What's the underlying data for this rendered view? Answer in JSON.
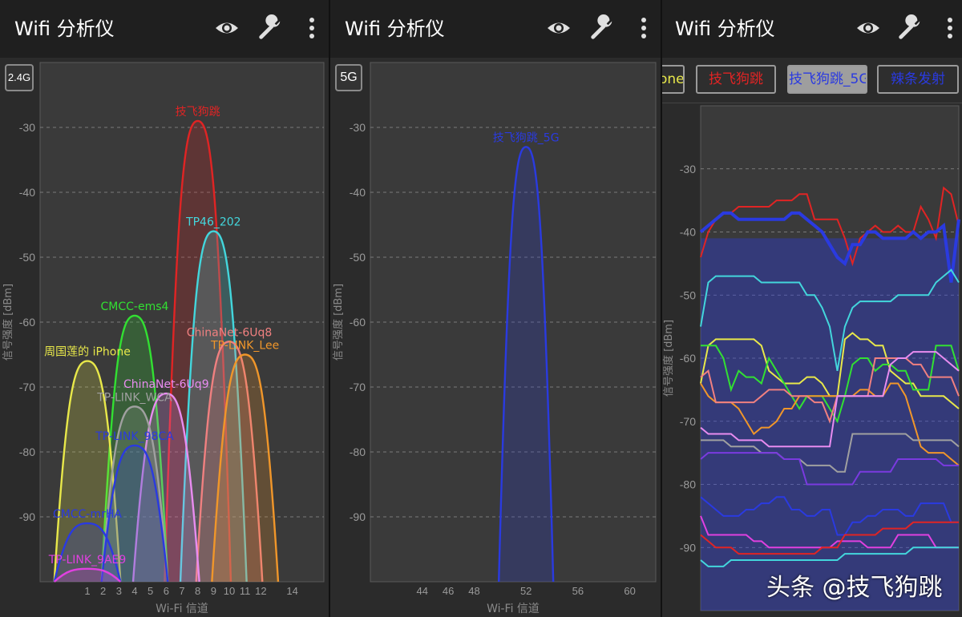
{
  "app": {
    "title": "Wifi 分析仪",
    "icons": [
      "eye-icon",
      "wrench-icon",
      "more-vert-icon"
    ]
  },
  "colors": {
    "bar": "#1f1f1f",
    "panel": "#2b2b2b",
    "plot": "#3a3a3a",
    "grid": "#8f8f8f",
    "axis": "#9a9a9a"
  },
  "panel1": {
    "band": "2.4G",
    "chart_data": {
      "type": "area",
      "xlabel": "Wi-Fi 信道",
      "ylabel": "信号强度 [dBm]",
      "ylim": [
        -100,
        -20
      ],
      "yticks": [
        -30,
        -40,
        -50,
        -60,
        -70,
        -80,
        -90
      ],
      "xticks": [
        1,
        2,
        3,
        4,
        5,
        6,
        7,
        8,
        9,
        10,
        11,
        12,
        14
      ],
      "xlim": [
        -2,
        16
      ],
      "grid": true,
      "series": [
        {
          "name": "技飞狗跳",
          "center": 8,
          "peak": -29,
          "color": "#e02424"
        },
        {
          "name": "TP46_202",
          "center": 9,
          "peak": -46,
          "color": "#43d6dc"
        },
        {
          "name": "CMCC-ems4",
          "center": 4,
          "peak": -59,
          "color": "#32e032"
        },
        {
          "name": "ChinaNet-6Uq8",
          "center": 10,
          "peak": -63,
          "color": "#f08080"
        },
        {
          "name": "TP-LINK_Lee",
          "center": 11,
          "peak": -65,
          "color": "#f0962a"
        },
        {
          "name": "周国莲的 iPhone",
          "center": 1,
          "peak": -66,
          "color": "#e8e84a"
        },
        {
          "name": "ChinaNet-6Uq9",
          "center": 6,
          "peak": -71,
          "color": "#e88cf0"
        },
        {
          "name": "TP-LINK_WCA",
          "center": 4,
          "peak": -73,
          "color": "#a0a0a0"
        },
        {
          "name": "TP-LINK_98CA",
          "center": 4,
          "peak": -79,
          "color": "#2a3ae0"
        },
        {
          "name": "CMCC-mrHA",
          "center": 1,
          "peak": -91,
          "color": "#2a3ae0"
        },
        {
          "name": "TP-LINK_9AE9",
          "center": 1,
          "peak": -98,
          "color": "#e040e0"
        }
      ]
    }
  },
  "panel2": {
    "band": "5G",
    "chart_data": {
      "type": "area",
      "xlabel": "Wi-Fi 信道",
      "ylabel": "信号强度 [dBm]",
      "ylim": [
        -100,
        -20
      ],
      "yticks": [
        -30,
        -40,
        -50,
        -60,
        -70,
        -80,
        -90
      ],
      "xticks": [
        44,
        46,
        48,
        52,
        56,
        60
      ],
      "xlim": [
        40,
        62
      ],
      "grid": true,
      "series": [
        {
          "name": "技飞狗跳_5G",
          "center": 52,
          "peak": -33,
          "color": "#2a3ae0"
        }
      ]
    }
  },
  "panel3": {
    "tabs": [
      {
        "label": "one",
        "color": "#e8e84a"
      },
      {
        "label": "技飞狗跳",
        "color": "#e02424"
      },
      {
        "label": "技飞狗跳_5G",
        "color": "#2a3ae0",
        "active": true
      },
      {
        "label": "辣条发射",
        "color": "#2a3ae0"
      }
    ],
    "chart_data": {
      "type": "line",
      "ylabel": "信号强度 [dBm]",
      "ylim": [
        -100,
        -20
      ],
      "yticks": [
        -30,
        -40,
        -50,
        -60,
        -70,
        -80,
        -90
      ],
      "grid": true,
      "series": [
        {
          "color": "#e02424",
          "values": [
            -44,
            -40,
            -38,
            -37,
            -37,
            -36,
            -36,
            -36,
            -36,
            -36,
            -35,
            -35,
            -35,
            -34,
            -34,
            -38,
            -38,
            -38,
            -38,
            -41,
            -45,
            -41,
            -40,
            -39,
            -40,
            -40,
            -39,
            -40,
            -40,
            -36,
            -38,
            -41,
            -33,
            -34,
            -39
          ]
        },
        {
          "color": "#2a3ae0",
          "values": [
            -40,
            -39,
            -38,
            -37,
            -37,
            -38,
            -38,
            -38,
            -38,
            -38,
            -38,
            -38,
            -37,
            -37,
            -38,
            -39,
            -40,
            -42,
            -44,
            -45,
            -42,
            -42,
            -40,
            -40,
            -41,
            -41,
            -41,
            -41,
            -40,
            -41,
            -40,
            -40,
            -39,
            -48,
            -38
          ]
        },
        {
          "color": "#43d6dc",
          "values": [
            -55,
            -48,
            -47,
            -47,
            -47,
            -47,
            -47,
            -47,
            -48,
            -48,
            -48,
            -48,
            -48,
            -48,
            -50,
            -50,
            -52,
            -55,
            -62,
            -55,
            -52,
            -51,
            -51,
            -51,
            -51,
            -51,
            -50,
            -50,
            -50,
            -50,
            -50,
            -48,
            -47,
            -46,
            -48
          ]
        },
        {
          "color": "#e8e84a",
          "values": [
            -64,
            -58,
            -57,
            -57,
            -57,
            -57,
            -57,
            -57,
            -58,
            -62,
            -63,
            -64,
            -64,
            -64,
            -63,
            -63,
            -64,
            -66,
            -66,
            -57,
            -56,
            -57,
            -57,
            -58,
            -58,
            -62,
            -63,
            -64,
            -64,
            -66,
            -66,
            -66,
            -66,
            -67,
            -68
          ]
        },
        {
          "color": "#32e032",
          "values": [
            -58,
            -58,
            -58,
            -60,
            -65,
            -62,
            -63,
            -63,
            -64,
            -60,
            -62,
            -64,
            -66,
            -68,
            -66,
            -66,
            -66,
            -68,
            -70,
            -66,
            -61,
            -60,
            -60,
            -62,
            -61,
            -61,
            -62,
            -62,
            -65,
            -65,
            -65,
            -58,
            -58,
            -58,
            -62
          ]
        },
        {
          "color": "#f0962a",
          "values": [
            -64,
            -66,
            -67,
            -67,
            -67,
            -68,
            -70,
            -72,
            -71,
            -71,
            -70,
            -68,
            -68,
            -66,
            -66,
            -66,
            -66,
            -66,
            -66,
            -66,
            -66,
            -65,
            -65,
            -66,
            -66,
            -64,
            -64,
            -66,
            -70,
            -74,
            -75,
            -75,
            -75,
            -76,
            -77
          ]
        },
        {
          "color": "#f08080",
          "values": [
            -63,
            -62,
            -67,
            -67,
            -67,
            -67,
            -67,
            -67,
            -66,
            -65,
            -65,
            -65,
            -66,
            -66,
            -66,
            -67,
            -67,
            -70,
            -66,
            -66,
            -66,
            -66,
            -66,
            -60,
            -60,
            -60,
            -60,
            -60,
            -61,
            -61,
            -63,
            -63,
            -63,
            -63,
            -66
          ]
        },
        {
          "color": "#e88cf0",
          "values": [
            -71,
            -72,
            -72,
            -72,
            -72,
            -73,
            -73,
            -73,
            -73,
            -74,
            -74,
            -74,
            -74,
            -74,
            -74,
            -74,
            -74,
            -74,
            -66,
            -66,
            -66,
            -66,
            -66,
            -66,
            -66,
            -61,
            -60,
            -60,
            -59,
            -59,
            -59,
            -59,
            -60,
            -61,
            -62
          ]
        },
        {
          "color": "#a0a0a0",
          "values": [
            -73,
            -73,
            -73,
            -73,
            -74,
            -74,
            -74,
            -74,
            -75,
            -75,
            -75,
            -76,
            -76,
            -76,
            -77,
            -77,
            -77,
            -77,
            -78,
            -78,
            -72,
            -72,
            -72,
            -72,
            -72,
            -72,
            -72,
            -72,
            -73,
            -73,
            -73,
            -73,
            -73,
            -73,
            -74
          ]
        },
        {
          "color": "#7a3ae0",
          "values": [
            -76,
            -75,
            -75,
            -75,
            -75,
            -75,
            -75,
            -75,
            -75,
            -75,
            -75,
            -76,
            -76,
            -76,
            -80,
            -80,
            -80,
            -80,
            -80,
            -80,
            -80,
            -78,
            -78,
            -78,
            -78,
            -78,
            -76,
            -76,
            -76,
            -76,
            -76,
            -76,
            -77,
            -77,
            -77
          ]
        },
        {
          "color": "#2a3ae0",
          "values": [
            -82,
            -83,
            -84,
            -85,
            -85,
            -85,
            -84,
            -84,
            -83,
            -83,
            -82,
            -82,
            -84,
            -84,
            -85,
            -85,
            -84,
            -84,
            -88,
            -88,
            -86,
            -86,
            -85,
            -85,
            -84,
            -84,
            -84,
            -85,
            -85,
            -83,
            -83,
            -83,
            -83,
            -86,
            -86
          ]
        },
        {
          "color": "#e040e0",
          "values": [
            -85,
            -88,
            -88,
            -88,
            -88,
            -88,
            -88,
            -89,
            -89,
            -90,
            -90,
            -90,
            -90,
            -90,
            -90,
            -90,
            -90,
            -90,
            -89,
            -89,
            -89,
            -89,
            -90,
            -90,
            -90,
            -90,
            -88,
            -88,
            -88,
            -88,
            -88,
            -90,
            -90,
            -90,
            -90
          ]
        },
        {
          "color": "#e02424",
          "values": [
            -88,
            -89,
            -90,
            -90,
            -90,
            -91,
            -91,
            -91,
            -91,
            -91,
            -91,
            -91,
            -91,
            -91,
            -91,
            -91,
            -90,
            -90,
            -90,
            -88,
            -88,
            -88,
            -88,
            -88,
            -87,
            -87,
            -87,
            -87,
            -86,
            -86,
            -86,
            -86,
            -86,
            -86,
            -86
          ]
        },
        {
          "color": "#43d6dc",
          "values": [
            -92,
            -93,
            -93,
            -93,
            -92,
            -92,
            -92,
            -92,
            -92,
            -92,
            -92,
            -92,
            -92,
            -92,
            -92,
            -92,
            -92,
            -92,
            -92,
            -91,
            -91,
            -91,
            -91,
            -91,
            -91,
            -91,
            -91,
            -91,
            -90,
            -90,
            -90,
            -90,
            -90,
            -90,
            -90
          ]
        }
      ]
    }
  },
  "watermark": "头条 @技飞狗跳"
}
